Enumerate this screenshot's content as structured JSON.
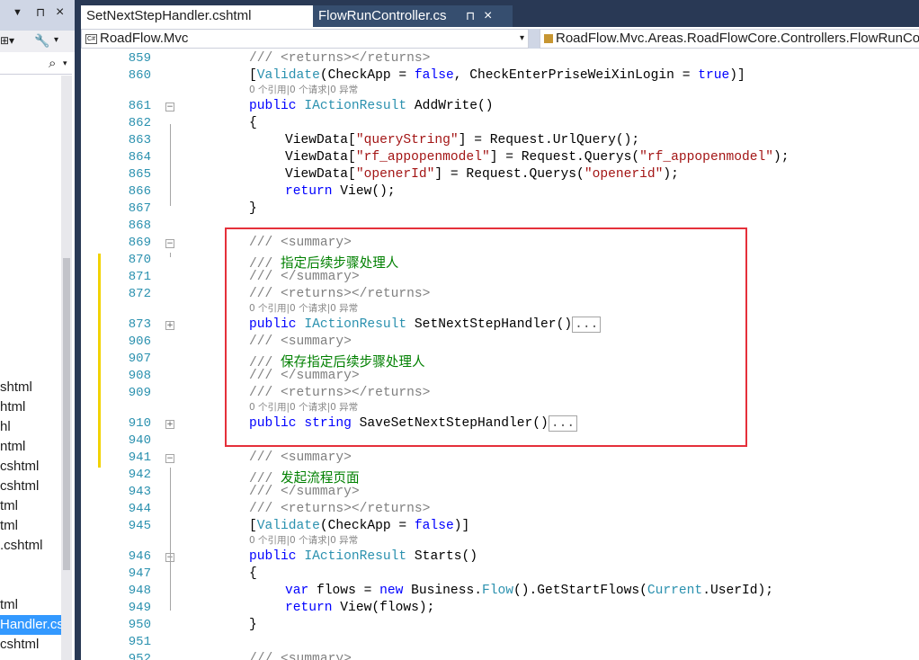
{
  "tabs": [
    {
      "label": "SetNextStepHandler.cshtml"
    },
    {
      "label": "FlowRunController.cs",
      "pin": "⊓",
      "close": "×"
    }
  ],
  "left_panel": {
    "pin": "⊓",
    "close": "×",
    "search_icon": "⌕",
    "files": [
      "shtml",
      "html",
      "hl",
      "ntml",
      "cshtml",
      "cshtml",
      "tml",
      "tml",
      ".cshtml",
      "tml",
      "Handler.cs",
      "cshtml"
    ]
  },
  "navbar": {
    "project": "RoadFlow.Mvc",
    "class": "RoadFlow.Mvc.Areas.RoadFlowCore.Controllers.FlowRunController"
  },
  "code": {
    "lens": "0 个引用|0 个请求|0 异常",
    "lines": [
      {
        "n": "859",
        "t": "doc_returns"
      },
      {
        "n": "860",
        "t": "attr1"
      },
      {
        "n": "861",
        "t": "addwrite"
      },
      {
        "n": "862",
        "t": "open"
      },
      {
        "n": "863",
        "t": "vd1"
      },
      {
        "n": "864",
        "t": "vd2"
      },
      {
        "n": "865",
        "t": "vd3"
      },
      {
        "n": "866",
        "t": "ret"
      },
      {
        "n": "867",
        "t": "close"
      },
      {
        "n": "868",
        "t": "blank"
      },
      {
        "n": "869",
        "t": "sum_open"
      },
      {
        "n": "870",
        "t": "sum_text1"
      },
      {
        "n": "871",
        "t": "sum_close"
      },
      {
        "n": "872",
        "t": "doc_returns"
      },
      {
        "n": "873",
        "t": "set_next"
      },
      {
        "n": "906",
        "t": "sum_open"
      },
      {
        "n": "907",
        "t": "sum_text2"
      },
      {
        "n": "908",
        "t": "sum_close"
      },
      {
        "n": "909",
        "t": "doc_returns"
      },
      {
        "n": "910",
        "t": "save_set"
      },
      {
        "n": "940",
        "t": "blank"
      },
      {
        "n": "941",
        "t": "sum_open"
      },
      {
        "n": "942",
        "t": "sum_text3"
      },
      {
        "n": "943",
        "t": "sum_close"
      },
      {
        "n": "944",
        "t": "doc_returns"
      },
      {
        "n": "945",
        "t": "attr2"
      },
      {
        "n": "946",
        "t": "starts"
      },
      {
        "n": "947",
        "t": "open"
      },
      {
        "n": "948",
        "t": "flows"
      },
      {
        "n": "949",
        "t": "ret_flows"
      },
      {
        "n": "950",
        "t": "close"
      },
      {
        "n": "951",
        "t": "blank"
      },
      {
        "n": "952",
        "t": "sum_open"
      }
    ]
  },
  "text": {
    "doc_returns": "/// <returns></returns>",
    "sum_open": "/// <summary>",
    "sum_close": "/// </summary>",
    "sum_text1": "指定后续步骤处理人",
    "sum_text2": "保存指定后续步骤处理人",
    "sum_text3": "发起流程页面",
    "slashes": "/// ",
    "attr_name": "Validate",
    "check_app": "CheckApp",
    "check_weixin": "CheckEnterPriseWeiXinLogin",
    "false_kw": "false",
    "true_kw": "true",
    "public_kw": "public",
    "iaction": "IActionResult",
    "string_kw": "string",
    "addwrite": "AddWrite",
    "set_next": "SetNextStepHandler",
    "save_set": "SaveSetNextStepHandler",
    "starts": "Starts",
    "viewdata": "ViewData",
    "request": "Request",
    "urlquery": "UrlQuery",
    "querys": "Querys",
    "querystring": "\"queryString\"",
    "rf_appopenmodel": "\"rf_appopenmodel\"",
    "openerId": "\"openerId\"",
    "openerid": "\"openerid\"",
    "return_kw": "return",
    "view": "View",
    "var_kw": "var",
    "flows": "flows",
    "new_kw": "new",
    "business": "Business",
    "flow": "Flow",
    "getstart": "GetStartFlows",
    "current": "Current",
    "userid": "UserId",
    "ellipsis": "..."
  }
}
